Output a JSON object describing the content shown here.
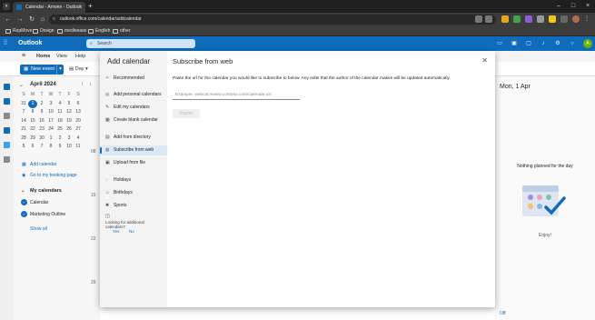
{
  "browser": {
    "tab_title": "Calendar - Arrwen - Outlook",
    "url": "outlook.office.com/calendar/addcalendar",
    "bookmarks": [
      "RepMove",
      "Design",
      "medieease",
      "English",
      "other"
    ]
  },
  "outlook": {
    "app_name": "Outlook",
    "search_placeholder": "Search",
    "ribbon_tabs": [
      "Home",
      "View",
      "Help"
    ],
    "new_event_label": "New event",
    "view_label": "Day"
  },
  "mini_calendar": {
    "month_label": "April 2024",
    "weekday_headers": [
      "S",
      "M",
      "T",
      "W",
      "T",
      "F",
      "S"
    ],
    "weeks": [
      [
        "31",
        "1",
        "2",
        "3",
        "4",
        "5",
        "6"
      ],
      [
        "7",
        "8",
        "9",
        "10",
        "11",
        "12",
        "13"
      ],
      [
        "14",
        "15",
        "16",
        "17",
        "18",
        "19",
        "20"
      ],
      [
        "21",
        "22",
        "23",
        "24",
        "25",
        "26",
        "27"
      ],
      [
        "28",
        "29",
        "30",
        "1",
        "2",
        "3",
        "4"
      ],
      [
        "5",
        "6",
        "7",
        "8",
        "9",
        "10",
        "11"
      ]
    ]
  },
  "left_pane": {
    "add_calendar": "Add calendar",
    "booking_page": "Go to my booking page",
    "my_calendars_header": "My calendars",
    "calendars": [
      "Calendar",
      "Marketing Outline"
    ],
    "show_all": "Show all"
  },
  "calendar_canvas": {
    "hours": [
      "08",
      "15",
      "22",
      "29"
    ]
  },
  "right_pane": {
    "date_heading": "Mon, 1 Apr",
    "empty_message": "Nothing planned for the day",
    "enjoy": "Enjoy!",
    "footer_link": "Off"
  },
  "dialog": {
    "title": "Add calendar",
    "nav_items": [
      {
        "label": "Recommended",
        "icon": "lightbulb-icon"
      },
      {
        "label": "Add personal calendars",
        "icon": "person-calendar-icon"
      },
      {
        "label": "Edit my calendars",
        "icon": "edit-icon"
      },
      {
        "label": "Create blank calendar",
        "icon": "calendar-add-icon"
      },
      {
        "label": "Add from directory",
        "icon": "directory-icon"
      },
      {
        "label": "Subscribe from web",
        "icon": "globe-icon"
      },
      {
        "label": "Upload from file",
        "icon": "upload-icon"
      },
      {
        "label": "Holidays",
        "icon": "holiday-icon"
      },
      {
        "label": "Birthdays",
        "icon": "birthday-icon"
      },
      {
        "label": "Sports",
        "icon": "sports-icon"
      }
    ],
    "selected_nav": "Subscribe from web",
    "feedback_question": "Looking for additional calendars?",
    "feedback_yes": "Yes",
    "feedback_no": "No",
    "main_title": "Subscribe from web",
    "description": "Paste the url for the calendar you would like to subscribe to below. Any edits that the author of the calendar makes will be updated automatically.",
    "url_placeholder": "Example: webcal://www.contoso.com/calendar.ics",
    "url_value": "",
    "import_label": "Import"
  },
  "colors": {
    "brand": "#0f6cbd",
    "selected_nav_bg": "#dbe8f6"
  }
}
